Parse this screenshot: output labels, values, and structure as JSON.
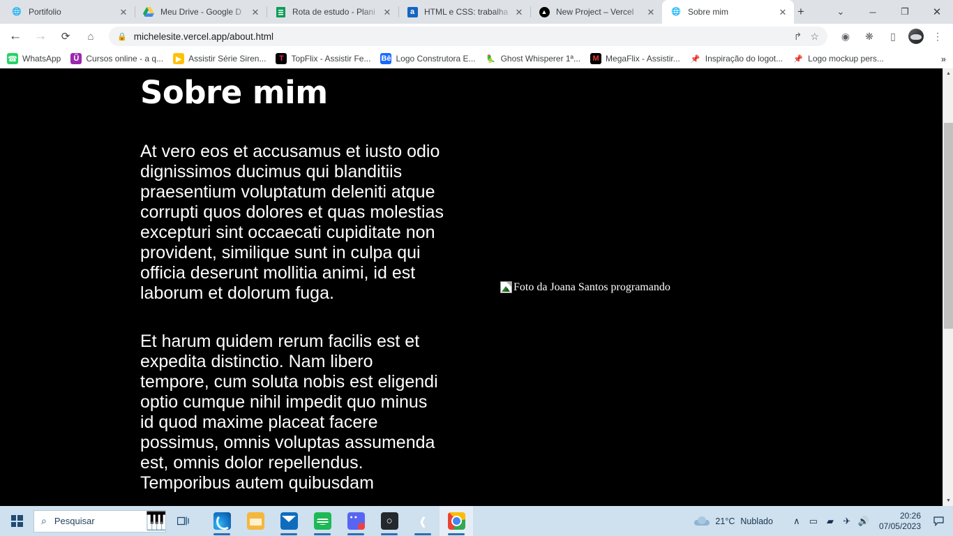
{
  "browser": {
    "tabs": [
      {
        "title": "Portifolio",
        "icon": "globe-icon",
        "active": false
      },
      {
        "title": "Meu Drive - Google D",
        "icon": "google-drive-icon",
        "active": false
      },
      {
        "title": "Rota de estudo - Plani",
        "icon": "google-sheets-icon",
        "active": false
      },
      {
        "title": "HTML e CSS: trabalha",
        "icon": "alura-icon",
        "active": false
      },
      {
        "title": "New Project – Vercel",
        "icon": "vercel-icon",
        "active": false
      },
      {
        "title": "Sobre mim",
        "icon": "globe-icon",
        "active": true
      }
    ],
    "new_tab_label": "+",
    "window_controls": {
      "tabsearch": "⌄",
      "minimize": "─",
      "maximize": "❐",
      "close": "✕"
    },
    "toolbar": {
      "back": "←",
      "forward": "→",
      "reload": "⟳",
      "home": "⌂",
      "lock": "🔒",
      "url": "michelesite.vercel.app/about.html",
      "share": "↱",
      "bookmark_star": "☆",
      "lens": "◑",
      "extensions": "🧩",
      "side_panel": "❑",
      "profile": "avatar",
      "menu": "⋮"
    },
    "bookmarks": [
      {
        "label": "WhatsApp",
        "icon": "whatsapp-icon",
        "glyph": "✆"
      },
      {
        "label": "Cursos online - a q...",
        "icon": "udemy-icon",
        "glyph": "Ũ"
      },
      {
        "label": "Assistir Série Siren...",
        "icon": "play-icon",
        "glyph": "▶"
      },
      {
        "label": "TopFlix - Assistir Fe...",
        "icon": "topflix-icon",
        "glyph": "T"
      },
      {
        "label": "Logo Construtora E...",
        "icon": "behance-icon",
        "glyph": "Bē"
      },
      {
        "label": "Ghost Whisperer 1ª...",
        "icon": "ghost-icon",
        "glyph": "🦜"
      },
      {
        "label": "MegaFlix - Assistir...",
        "icon": "megaflix-icon",
        "glyph": "M"
      },
      {
        "label": "Inspiração do logot...",
        "icon": "pinterest-icon",
        "glyph": "📌"
      },
      {
        "label": "Logo mockup pers...",
        "icon": "pinterest-icon",
        "glyph": "📌"
      }
    ],
    "bookmarks_overflow": "»"
  },
  "page": {
    "title": "Sobre mim",
    "paragraph1": "At vero eos et accusamus et iusto odio dignissimos ducimus qui blanditiis praesentium voluptatum deleniti atque corrupti quos dolores et quas molestias excepturi sint occaecati cupiditate non provident, similique sunt in culpa qui officia deserunt mollitia animi, id est laborum et dolorum fuga.",
    "paragraph2": "Et harum quidem rerum facilis est et expedita distinctio. Nam libero tempore, cum soluta nobis est eligendi optio cumque nihil impedit quo minus id quod maxime placeat facere possimus, omnis voluptas assumenda est, omnis dolor repellendus. Temporibus autem quibusdam",
    "image_alt": "Foto da Joana Santos programando",
    "background_color": "#000000",
    "text_color": "#ffffff",
    "scrollbar": {
      "up_arrow": "▲",
      "down_arrow": "▼"
    }
  },
  "taskbar": {
    "start_label": "start-button",
    "search_placeholder": "Pesquisar",
    "search_icon": "⌕",
    "piano_icon": "🎹",
    "taskview_icon": "❐",
    "apps": [
      {
        "name": "edge",
        "running": true,
        "active": false
      },
      {
        "name": "file-explorer",
        "running": false,
        "active": false
      },
      {
        "name": "mail",
        "running": true,
        "active": false
      },
      {
        "name": "spotify",
        "running": true,
        "active": false
      },
      {
        "name": "discord",
        "running": true,
        "active": false
      },
      {
        "name": "github",
        "running": true,
        "active": false
      },
      {
        "name": "vscode",
        "running": true,
        "active": false
      },
      {
        "name": "chrome",
        "running": true,
        "active": true
      }
    ],
    "weather": {
      "temperature": "21°C",
      "condition": "Nublado"
    },
    "tray": {
      "chevron": "∧",
      "camera": "▭",
      "battery": "▰",
      "airplane": "✈",
      "volume": "🔊"
    },
    "clock": {
      "time": "20:26",
      "date": "07/05/2023"
    },
    "notification_icon": "⬜"
  }
}
